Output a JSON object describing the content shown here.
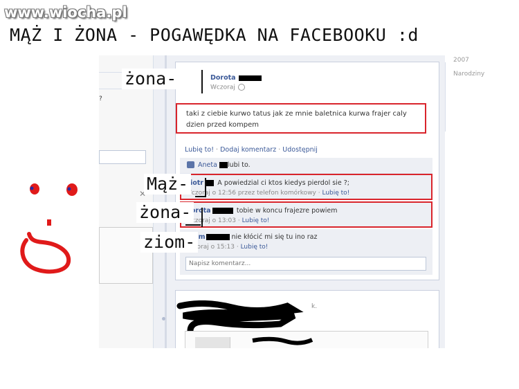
{
  "watermark": "www.wiocha.pl",
  "headline": "MĄŻ I ŻONA - POGAWĘDKA NA FACEBOOKU :d",
  "labels": {
    "zona_top": "żona-",
    "maz": "Mąż-",
    "zona_mid": "żona-",
    "ziom": "ziom-"
  },
  "left_panel": {
    "question_mark": "?"
  },
  "right_panel": {
    "year": "2007",
    "birthdays": "Narodziny"
  },
  "post": {
    "author": "Dorota",
    "time": "Wczoraj",
    "text": "taki z ciebie kurwo tatus jak ze mnie baletnica kurwa frajer caly dzien przed kompem",
    "actions": [
      "Lubię to!",
      "Dodaj komentarz",
      "Udostępnij"
    ],
    "likes": {
      "name": "Aneta",
      "rest": "lubi to."
    },
    "comments": [
      {
        "author": "Piotr",
        "text": "A powiedzial ci ktos kiedys pierdol sie ?;",
        "meta": "Wczoraj o 12:56 przez telefon komórkowy",
        "like": "Lubię to!",
        "highlighted": true
      },
      {
        "author": "Dorota",
        "text": "tobie w koncu frajezre powiem",
        "meta": "Wczoraj o 13:03",
        "like": "Lubię to!",
        "highlighted": true
      },
      {
        "author": "Adam",
        "text": "nie kłócić mi się tu ino raz",
        "meta": "Wczoraj o 15:13",
        "like": "Lubię to!",
        "highlighted": false
      }
    ],
    "composer_placeholder": "Napisz komentarz..."
  },
  "second_post": {
    "tail": "k."
  },
  "colors": {
    "facebook_blue": "#3b5998",
    "highlight_red": "#d9242b",
    "comment_bg": "#edeff4"
  }
}
